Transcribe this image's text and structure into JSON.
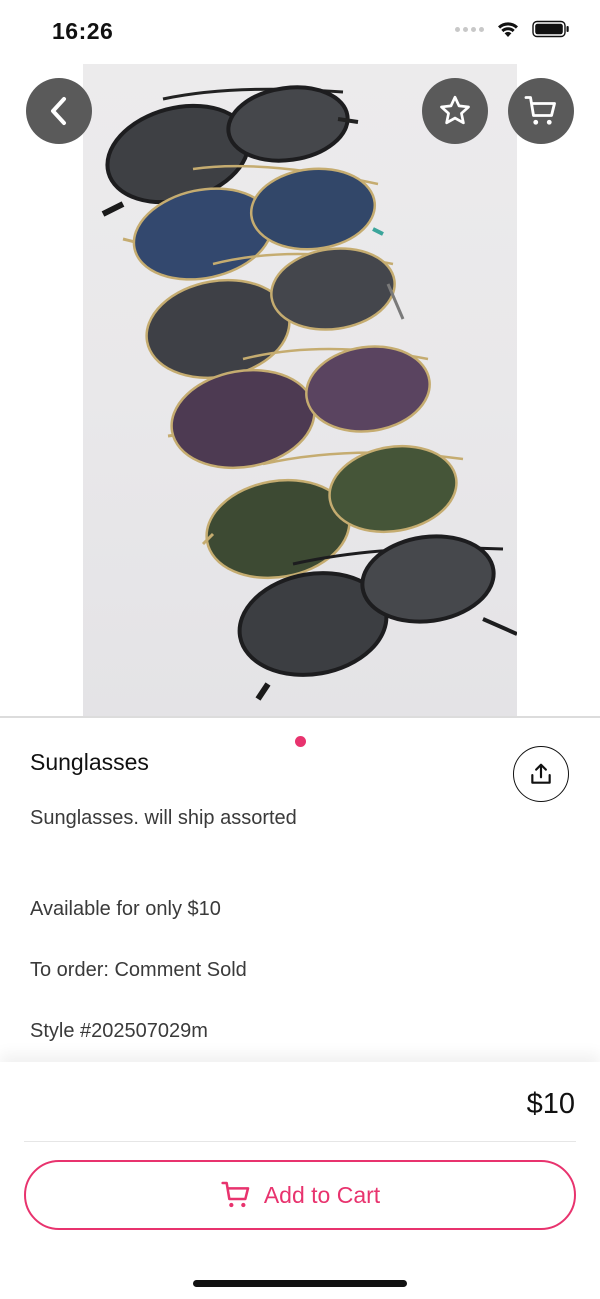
{
  "status": {
    "time": "16:26"
  },
  "hero": {
    "page_count": 1,
    "active_page": 1
  },
  "product": {
    "title": "Sunglasses",
    "description": "Sunglasses. will ship assorted",
    "lines": [
      "Available for only $10",
      "To order: Comment Sold",
      "Style #202507029m"
    ],
    "price": "$10"
  },
  "actions": {
    "add_to_cart_label": "Add to Cart"
  },
  "icons": {
    "back": "chevron-left-icon",
    "favorite": "star-icon",
    "cart": "cart-icon",
    "share": "share-icon"
  },
  "colors": {
    "accent": "#e8336e",
    "overlay_button": "#5a5a5a"
  }
}
